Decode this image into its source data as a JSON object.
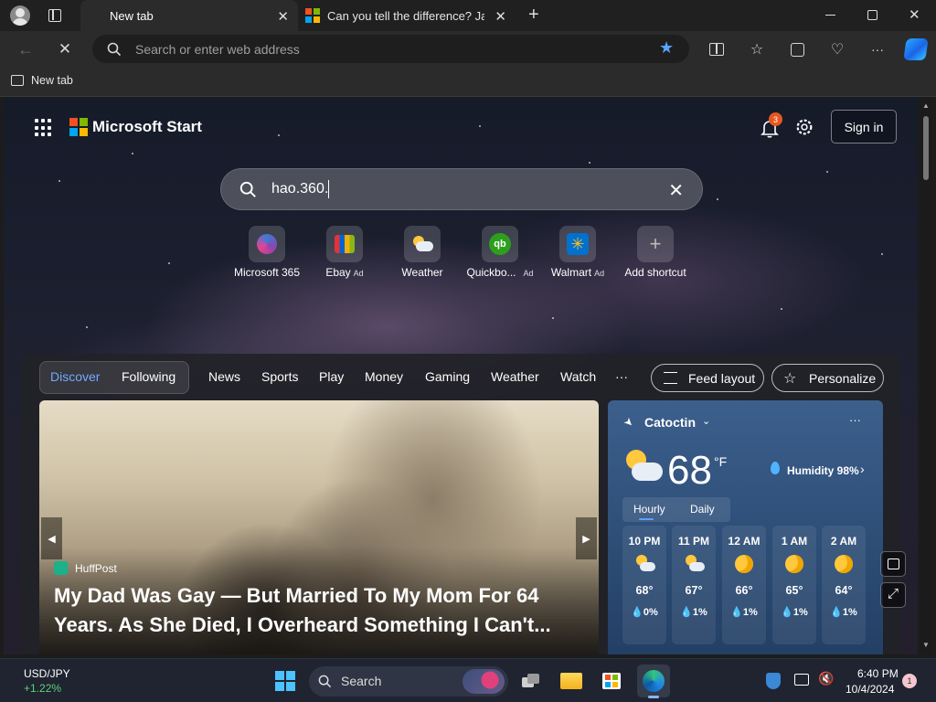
{
  "browser": {
    "tabs": [
      {
        "label": "New tab"
      },
      {
        "label": "Can you tell the difference? Jake"
      }
    ],
    "address_placeholder": "Search or enter web address",
    "favorites_bar": {
      "item": "New tab"
    }
  },
  "header": {
    "brand": "Microsoft Start",
    "notification_count": "3",
    "sign_in_label": "Sign in"
  },
  "search": {
    "value": "hao.360."
  },
  "shortcuts": [
    {
      "label": "Microsoft 365",
      "ad": ""
    },
    {
      "label": "Ebay",
      "ad": "Ad"
    },
    {
      "label": "Weather",
      "ad": ""
    },
    {
      "label": "Quickbo...",
      "ad": "Ad"
    },
    {
      "label": "Walmart",
      "ad": "Ad"
    },
    {
      "label": "Add shortcut",
      "ad": ""
    }
  ],
  "feed_nav": {
    "items": [
      "Discover",
      "Following",
      "News",
      "Sports",
      "Play",
      "Money",
      "Gaming",
      "Weather",
      "Watch",
      "···"
    ],
    "feed_layout_label": "Feed layout",
    "personalize_label": "Personalize"
  },
  "hero": {
    "publisher": "HuffPost",
    "headline": "My Dad Was Gay — But Married To My Mom For 64 Years. As She Died, I Overheard Something I Can't..."
  },
  "weather": {
    "location": "Catoctin",
    "temperature": "68",
    "unit": "°F",
    "humidity": "Humidity 98%",
    "tabs": [
      "Hourly",
      "Daily"
    ],
    "hours": [
      {
        "time": "10 PM",
        "temp": "68°",
        "precip": "0%"
      },
      {
        "time": "11 PM",
        "temp": "67°",
        "precip": "1%"
      },
      {
        "time": "12 AM",
        "temp": "66°",
        "precip": "1%"
      },
      {
        "time": "1 AM",
        "temp": "65°",
        "precip": "1%"
      },
      {
        "time": "2 AM",
        "temp": "64°",
        "precip": "1%"
      }
    ]
  },
  "taskbar": {
    "ticker_name": "USD/JPY",
    "ticker_change": "+1.22%",
    "search_label": "Search",
    "time": "6:40 PM",
    "date": "10/4/2024",
    "notification_count": "1"
  }
}
